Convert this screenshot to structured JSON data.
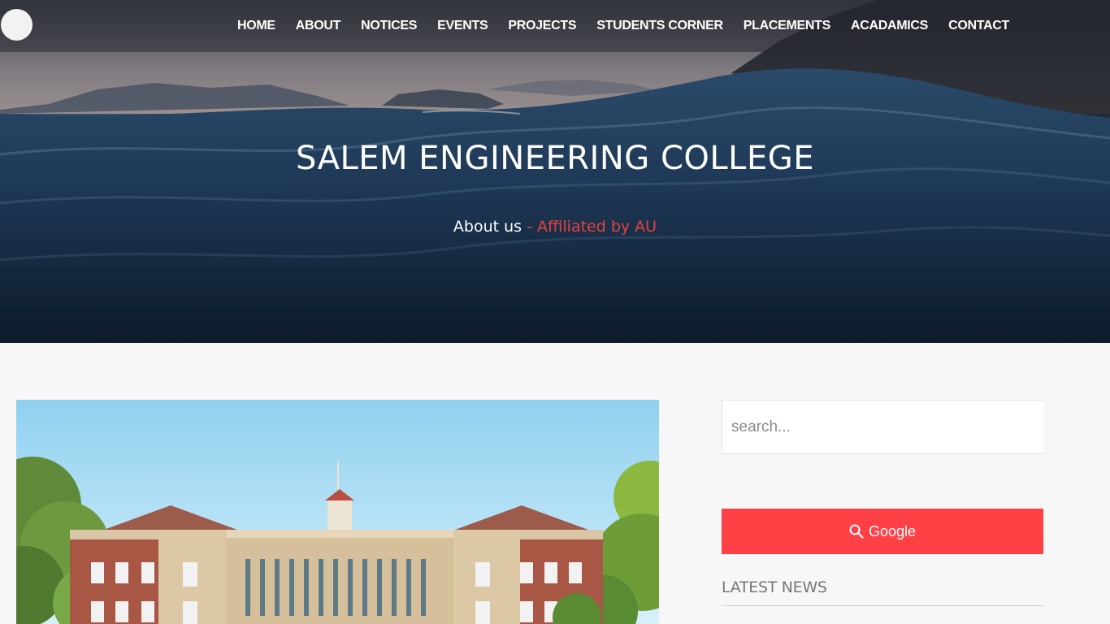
{
  "nav": {
    "items": [
      "HOME",
      "ABOUT",
      "NOTICES",
      "EVENTS",
      "PROJECTS",
      "STUDENTS CORNER",
      "PLACEMENTS",
      "ACADAMICS",
      "CONTACT"
    ]
  },
  "hero": {
    "title": "SALEM ENGINEERING COLLEGE",
    "subtitle": "About us",
    "subtitle_accent": "- Affiliated by AU"
  },
  "sidebar": {
    "search_placeholder": "search...",
    "google_button": "Google",
    "latest_news_heading": "LATEST NEWS"
  },
  "colors": {
    "accent": "#ff4146",
    "accent_text": "#e8413f",
    "nav_text": "#ffffff"
  },
  "icons": {
    "logo": "logo-circle",
    "search": "search-icon"
  }
}
